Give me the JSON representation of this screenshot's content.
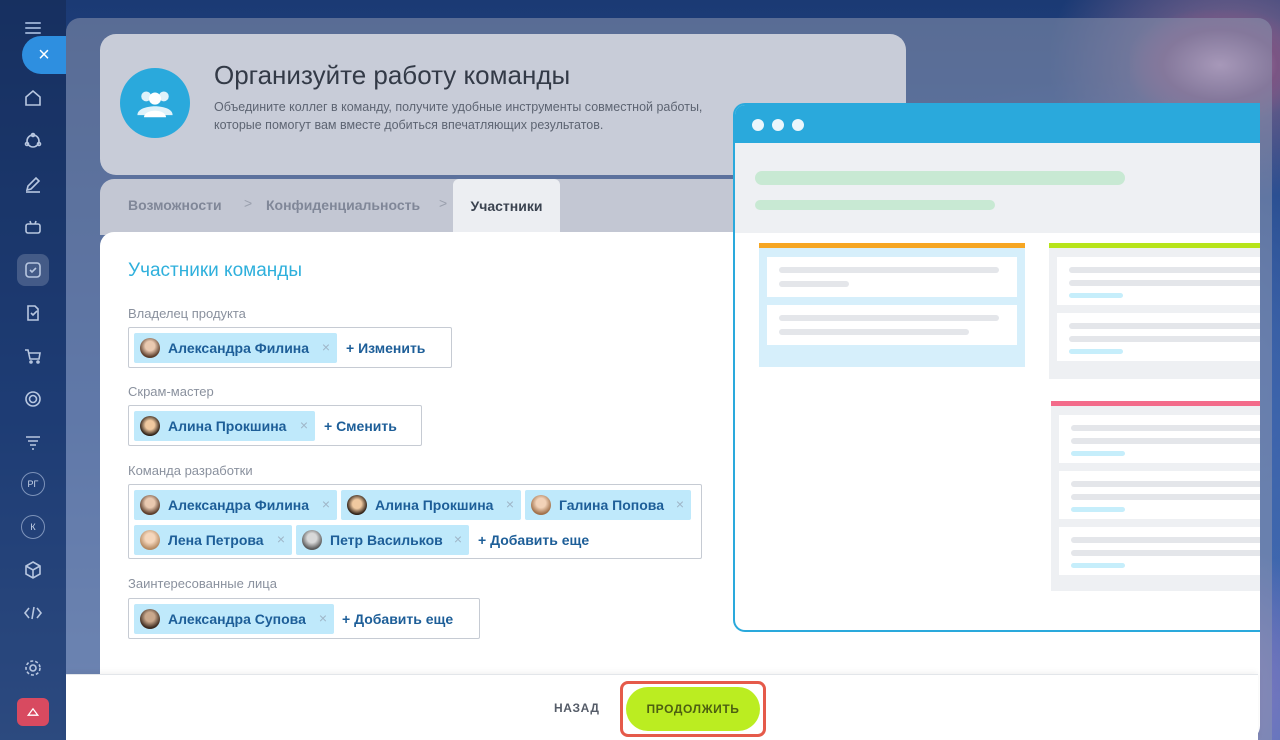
{
  "sidebar": {
    "close_symbol": "×",
    "icons": [
      "menu-icon",
      "close-icon",
      "home-icon",
      "crm-icon",
      "pen-icon",
      "robot-icon",
      "tasks-icon",
      "documents-icon",
      "cart-icon",
      "target-icon",
      "filter-icon",
      "group-avatar",
      "group-avatar",
      "box-icon",
      "code-icon",
      "settings-icon",
      "app-icon"
    ],
    "round_items": [
      "РГ",
      "К"
    ]
  },
  "header": {
    "title": "Организуйте работу команды",
    "description": "Объедините коллег в команду, получите удобные инструменты совместной работы, которые помогут вам вместе добиться впечатляющих результатов."
  },
  "tabs": {
    "items": [
      "Возможности",
      "Конфиденциальность",
      "Участники"
    ],
    "active": "Участники",
    "separator": ">"
  },
  "form": {
    "title": "Участники команды",
    "owner": {
      "label": "Владелец продукта",
      "members": [
        "Александра Филина"
      ],
      "action": "+ Изменить"
    },
    "scrum_master": {
      "label": "Скрам-мастер",
      "members": [
        "Алина Прокшина"
      ],
      "action": "+ Сменить"
    },
    "dev_team": {
      "label": "Команда разработки",
      "members": [
        "Александра Филина",
        "Алина Прокшина",
        "Галина Попова",
        "Лена Петрова",
        "Петр Васильков"
      ],
      "action": "+ Добавить еще"
    },
    "stakeholders": {
      "label": "Заинтересованные лица",
      "members": [
        "Александра Супова"
      ],
      "action": "+ Добавить еще"
    },
    "remove_symbol": "×"
  },
  "footer": {
    "back_label": "НАЗАД",
    "continue_label": "ПРОДОЛЖИТЬ"
  },
  "colors": {
    "accent": "#2aa9dc",
    "chip_bg": "#bfe9fb",
    "chip_text": "#1d5e98",
    "continue_bg": "#bbed21",
    "highlight_outline": "#e55a4a",
    "kanban_orange": "#f6a623",
    "kanban_green": "#b7e41a",
    "kanban_pink": "#f36b8a"
  }
}
